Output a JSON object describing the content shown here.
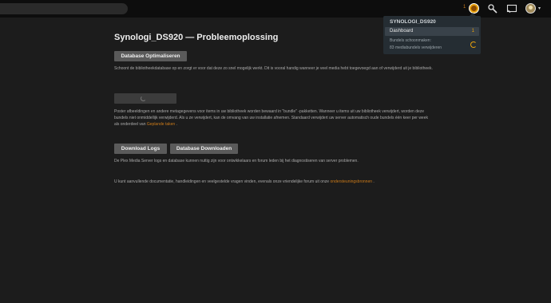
{
  "topbar": {
    "activity_count": "1",
    "server_menu_caret": "▾"
  },
  "dropdown": {
    "server_name": "SYNOLOGI_DS920",
    "dashboard_label": "Dashboard",
    "dashboard_count": "1",
    "task_line1": "Bundels schoonmaken:",
    "task_line2": "83 mediabundels verwijderen"
  },
  "main": {
    "title": "Synologi_DS920 — Probleemoplossing",
    "optimize_button": "Database Optimaliseren",
    "optimize_desc": "Schoont de bibliotheekdatabase op en zorgt er voor dat deze zo snel mogelijk werkt. Dit is vooral handig wanneer je veel media hebt toegevoegd aan of verwijderd uit je bibliotheek.",
    "bundles_desc_prefix": "Poster afbeeldingen en andere metagegevens voor items in uw bibliotheek worden bewaard in \"bundle\" -pakketten. Wanneer u items uit uw bibliotheek verwijdert, worden deze bundels niet onmiddellijk verwijderd. Als u ze verwijdert, kan de omvang van uw installatie afnemen. Standaard verwijdert uw server automatisch oude bundels één keer per week als onderdeel van ",
    "bundles_desc_link": "Geplande taken",
    "bundles_desc_suffix": " .",
    "download_logs_button": "Download Logs",
    "download_db_button": "Database Downloaden",
    "logs_desc": "De Plex Media Server logs en database kunnen nuttig zijn voor ontwikkelaars en forum leden bij het diagnostiseren van server problemen.",
    "docs_desc_prefix": "U kunt aanvullende documentatie, handleidingen en veelgestelde vragen vinden, evenals onze vriendelijke forum uit onze ",
    "docs_desc_link": "ondersteuningsbronnen",
    "docs_desc_suffix": " ."
  },
  "colors": {
    "accent": "#e5a00d",
    "link": "#cc7b19",
    "background": "#1c1c1c"
  }
}
